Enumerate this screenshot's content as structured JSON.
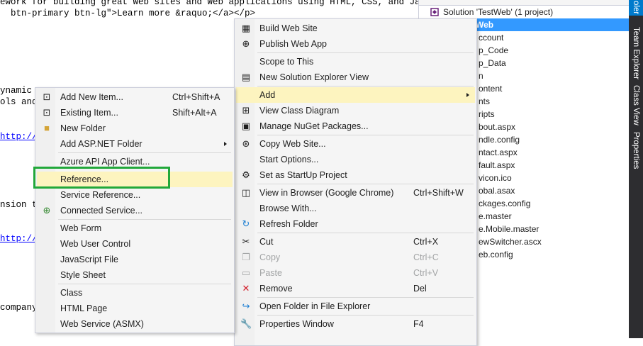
{
  "editor": {
    "lines": [
      "ework for building great Web sites and Web applications using HTML, CSS, and JavaScr",
      "  btn-primary btn-lg\">Learn more &raquo;</a></p>",
      "ynamic",
      "ols and",
      "http://g",
      "nsion t",
      "http://g",
      "company"
    ]
  },
  "solution_explorer": {
    "items": [
      "Solution 'TestWeb' (1 project)",
      "Web",
      "ccount",
      "p_Code",
      "p_Data",
      "n",
      "ontent",
      "nts",
      "ripts",
      "bout.aspx",
      "ndle.config",
      "ntact.aspx",
      "fault.aspx",
      "vicon.ico",
      "obal.asax",
      "ckages.config",
      "e.master",
      "e.Mobile.master",
      "ewSwitcher.ascx",
      "eb.config"
    ]
  },
  "side_tabs": [
    "oler",
    "Team Explorer",
    "Class View",
    "Properties"
  ],
  "context_menu": {
    "items": [
      {
        "label": "Build Web Site",
        "icon": "build-icon",
        "shortcut": ""
      },
      {
        "label": "Publish Web App",
        "icon": "publish-icon",
        "shortcut": ""
      },
      {
        "label": "Scope to This",
        "icon": "",
        "shortcut": ""
      },
      {
        "label": "New Solution Explorer View",
        "icon": "new-view-icon",
        "shortcut": ""
      },
      {
        "label": "Add",
        "icon": "",
        "shortcut": ""
      },
      {
        "label": "View Class Diagram",
        "icon": "class-diagram-icon",
        "shortcut": ""
      },
      {
        "label": "Manage NuGet Packages...",
        "icon": "nuget-icon",
        "shortcut": ""
      },
      {
        "label": "Copy Web Site...",
        "icon": "copy-website-icon",
        "shortcut": ""
      },
      {
        "label": "Start Options...",
        "icon": "",
        "shortcut": ""
      },
      {
        "label": "Set as StartUp Project",
        "icon": "gear-icon",
        "shortcut": ""
      },
      {
        "label": "View in Browser (Google Chrome)",
        "icon": "browser-icon",
        "shortcut": "Ctrl+Shift+W"
      },
      {
        "label": "Browse With...",
        "icon": "",
        "shortcut": ""
      },
      {
        "label": "Refresh Folder",
        "icon": "refresh-icon",
        "shortcut": ""
      },
      {
        "label": "Cut",
        "icon": "scissors-icon",
        "shortcut": "Ctrl+X"
      },
      {
        "label": "Copy",
        "icon": "copy-icon",
        "shortcut": "Ctrl+C"
      },
      {
        "label": "Paste",
        "icon": "paste-icon",
        "shortcut": "Ctrl+V"
      },
      {
        "label": "Remove",
        "icon": "remove-icon",
        "shortcut": "Del"
      },
      {
        "label": "Open Folder in File Explorer",
        "icon": "open-folder-icon",
        "shortcut": ""
      },
      {
        "label": "Properties Window",
        "icon": "wrench-icon",
        "shortcut": "F4"
      }
    ]
  },
  "add_submenu": {
    "items": [
      {
        "label": "Add New Item...",
        "icon": "new-item-icon",
        "shortcut": "Ctrl+Shift+A"
      },
      {
        "label": "Existing Item...",
        "icon": "existing-item-icon",
        "shortcut": "Shift+Alt+A"
      },
      {
        "label": "New Folder",
        "icon": "new-folder-icon",
        "shortcut": ""
      },
      {
        "label": "Add ASP.NET Folder",
        "icon": "",
        "shortcut": ""
      },
      {
        "label": "Azure API App Client...",
        "icon": "",
        "shortcut": ""
      },
      {
        "label": "Reference...",
        "icon": "",
        "shortcut": ""
      },
      {
        "label": "Service Reference...",
        "icon": "",
        "shortcut": ""
      },
      {
        "label": "Connected Service...",
        "icon": "connected-service-icon",
        "shortcut": ""
      },
      {
        "label": "Web Form",
        "icon": "",
        "shortcut": ""
      },
      {
        "label": "Web User Control",
        "icon": "",
        "shortcut": ""
      },
      {
        "label": "JavaScript File",
        "icon": "",
        "shortcut": ""
      },
      {
        "label": "Style Sheet",
        "icon": "",
        "shortcut": ""
      },
      {
        "label": "Class",
        "icon": "",
        "shortcut": ""
      },
      {
        "label": "HTML Page",
        "icon": "",
        "shortcut": ""
      },
      {
        "label": "Web Service (ASMX)",
        "icon": "",
        "shortcut": ""
      }
    ]
  },
  "colors": {
    "highlight": "#fdf4bf",
    "selection": "#3399ff",
    "callout": "#22a83a",
    "tab_bar": "#2d2d30",
    "active_tab": "#007acc"
  }
}
